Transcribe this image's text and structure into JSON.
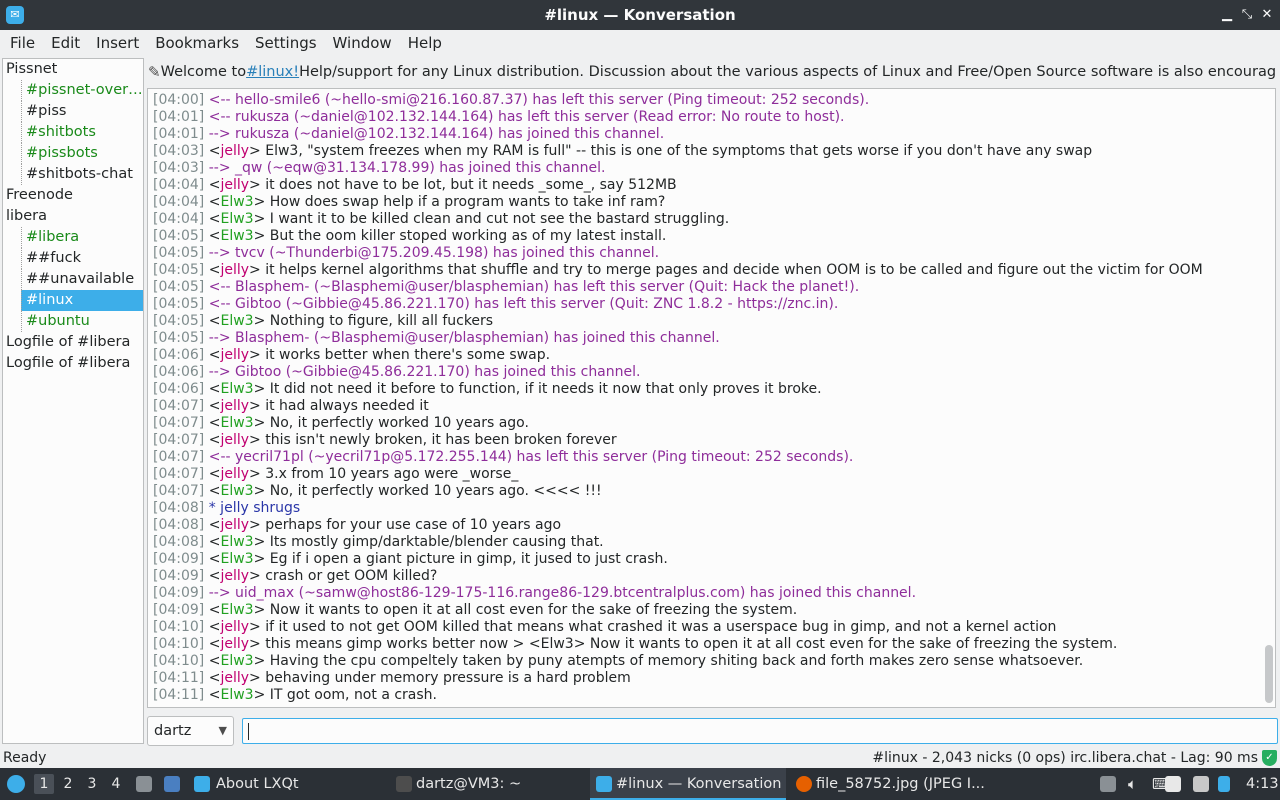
{
  "window": {
    "title": "#linux — Konversation"
  },
  "menubar": [
    "File",
    "Edit",
    "Insert",
    "Bookmarks",
    "Settings",
    "Window",
    "Help"
  ],
  "tree": [
    {
      "label": "Pissnet",
      "kind": "server"
    },
    {
      "label": "#pissnet-overview",
      "kind": "channel",
      "hl": true
    },
    {
      "label": "#piss",
      "kind": "channel",
      "hl": false
    },
    {
      "label": "#shitbots",
      "kind": "channel",
      "hl": true
    },
    {
      "label": "#pissbots",
      "kind": "channel",
      "hl": true
    },
    {
      "label": "#shitbots-chat",
      "kind": "channel",
      "hl": false
    },
    {
      "label": "Freenode",
      "kind": "server"
    },
    {
      "label": "libera",
      "kind": "server"
    },
    {
      "label": "#libera",
      "kind": "channel",
      "hl": true
    },
    {
      "label": "##fuck",
      "kind": "channel",
      "hl": false
    },
    {
      "label": "##unavailable",
      "kind": "channel",
      "hl": false
    },
    {
      "label": "#linux",
      "kind": "channel",
      "hl": false,
      "selected": true
    },
    {
      "label": "#ubuntu",
      "kind": "channel",
      "hl": true
    },
    {
      "label": "Logfile of #libera",
      "kind": "server"
    },
    {
      "label": "Logfile of #libera",
      "kind": "server"
    }
  ],
  "topic": {
    "prefix": "Welcome to ",
    "link": "#linux!",
    "rest": " Help/support for any Linux distribution. Discussion about the various aspects of Linux and Free/Open Source software is also encouraged. ..."
  },
  "messages": [
    {
      "ts": "[04:00]",
      "type": "sys",
      "text": "<-- hello-smile6 (~hello-smi@216.160.87.37) has left this server (Ping timeout: 252 seconds)."
    },
    {
      "ts": "[04:01]",
      "type": "sys",
      "text": "<-- rukusza (~daniel@102.132.144.164) has left this server (Read error: No route to host)."
    },
    {
      "ts": "[04:01]",
      "type": "sys",
      "text": "--> rukusza (~daniel@102.132.144.164) has joined this channel."
    },
    {
      "ts": "[04:03]",
      "type": "msg",
      "nick": "jelly",
      "text": " Elw3, \"system freezes when my RAM is full\" -- this is one of the symptoms that gets worse if you don't have any swap"
    },
    {
      "ts": "[04:03]",
      "type": "sys",
      "text": "--> _qw (~eqw@31.134.178.99) has joined this channel."
    },
    {
      "ts": "[04:04]",
      "type": "msg",
      "nick": "jelly",
      "text": " it does not have to be lot, but it needs _some_, say 512MB"
    },
    {
      "ts": "[04:04]",
      "type": "msg",
      "nick": "Elw3",
      "text": " How does swap help if a program wants to take inf ram?"
    },
    {
      "ts": "[04:04]",
      "type": "msg",
      "nick": "Elw3",
      "text": " I want it to be killed clean and cut not see the bastard struggling."
    },
    {
      "ts": "[04:05]",
      "type": "msg",
      "nick": "Elw3",
      "text": " But the oom killer stoped working as of my latest install."
    },
    {
      "ts": "[04:05]",
      "type": "sys",
      "text": "--> tvcv (~Thunderbi@175.209.45.198) has joined this channel."
    },
    {
      "ts": "[04:05]",
      "type": "msg",
      "nick": "jelly",
      "text": " it helps kernel algorithms that shuffle and try to merge pages and decide when OOM is to be called and figure out the victim for OOM"
    },
    {
      "ts": "[04:05]",
      "type": "sys",
      "text": "<-- Blasphem- (~Blasphemi@user/blasphemian) has left this server (Quit: Hack the planet!)."
    },
    {
      "ts": "[04:05]",
      "type": "sys",
      "text": "<-- Gibtoo (~Gibbie@45.86.221.170) has left this server (Quit: ZNC 1.8.2 - https://znc.in)."
    },
    {
      "ts": "[04:05]",
      "type": "msg",
      "nick": "Elw3",
      "text": " Nothing to figure, kill all fuckers"
    },
    {
      "ts": "[04:05]",
      "type": "sys",
      "text": "--> Blasphem- (~Blasphemi@user/blasphemian) has joined this channel."
    },
    {
      "ts": "[04:06]",
      "type": "msg",
      "nick": "jelly",
      "text": " it works better when there's some swap."
    },
    {
      "ts": "[04:06]",
      "type": "sys",
      "text": "--> Gibtoo (~Gibbie@45.86.221.170) has joined this channel."
    },
    {
      "ts": "[04:06]",
      "type": "msg",
      "nick": "Elw3",
      "text": " It did not need it before to function, if it needs it now that only proves it broke."
    },
    {
      "ts": "[04:07]",
      "type": "msg",
      "nick": "jelly",
      "text": " it had always needed it"
    },
    {
      "ts": "[04:07]",
      "type": "msg",
      "nick": "Elw3",
      "text": " No, it perfectly worked 10 years ago."
    },
    {
      "ts": "[04:07]",
      "type": "msg",
      "nick": "jelly",
      "text": " this isn't newly broken, it has been broken forever"
    },
    {
      "ts": "[04:07]",
      "type": "sys",
      "text": "<-- yecril71pl (~yecril71p@5.172.255.144) has left this server (Ping timeout: 252 seconds)."
    },
    {
      "ts": "[04:07]",
      "type": "msg",
      "nick": "jelly",
      "text": " 3.x from 10 years ago were _worse_"
    },
    {
      "ts": "[04:07]",
      "type": "msg",
      "nick": "Elw3",
      "text": " No, it perfectly worked 10 years ago. <<<< !!!"
    },
    {
      "ts": "[04:08]",
      "type": "action",
      "text": "* jelly shrugs"
    },
    {
      "ts": "[04:08]",
      "type": "msg",
      "nick": "jelly",
      "text": " perhaps for your use case of 10 years ago"
    },
    {
      "ts": "[04:08]",
      "type": "msg",
      "nick": "Elw3",
      "text": " Its mostly gimp/darktable/blender causing that."
    },
    {
      "ts": "[04:09]",
      "type": "msg",
      "nick": "Elw3",
      "text": " Eg if i open a giant picture in gimp, it jused to just crash."
    },
    {
      "ts": "[04:09]",
      "type": "msg",
      "nick": "jelly",
      "text": " crash or get OOM killed?"
    },
    {
      "ts": "[04:09]",
      "type": "sys",
      "text": "--> uid_max (~samw@host86-129-175-116.range86-129.btcentralplus.com) has joined this channel."
    },
    {
      "ts": "[04:09]",
      "type": "msg",
      "nick": "Elw3",
      "text": " Now it wants to open it at all cost even for the sake of freezing the system."
    },
    {
      "ts": "[04:10]",
      "type": "msg",
      "nick": "jelly",
      "text": " if it used to not get OOM killed that means what crashed it was a userspace bug in gimp, and not a kernel action"
    },
    {
      "ts": "[04:10]",
      "type": "msg",
      "nick": "jelly",
      "text": " this means gimp works better now > <Elw3> Now it wants to open it at all cost even for the sake of freezing the system."
    },
    {
      "ts": "[04:10]",
      "type": "msg",
      "nick": "Elw3",
      "text": " Having the cpu compeltely taken by puny atempts of memory shiting back and forth makes zero sense whatsoever."
    },
    {
      "ts": "[04:11]",
      "type": "msg",
      "nick": "jelly",
      "text": " behaving under memory pressure is a hard problem"
    },
    {
      "ts": "[04:11]",
      "type": "msg",
      "nick": "Elw3",
      "text": " IT got oom, not a crash."
    }
  ],
  "input": {
    "nick": "dartz",
    "value": ""
  },
  "status": {
    "left": "Ready",
    "right": "#linux - 2,043 nicks (0 ops)  irc.libera.chat - Lag: 90 ms"
  },
  "taskbar": {
    "desktops": [
      "1",
      "2",
      "3",
      "4"
    ],
    "tasks": [
      {
        "label": "About LXQt",
        "icon": "lxqt-icon"
      },
      {
        "label": "dartz@VM3: ~",
        "icon": "terminal-icon"
      },
      {
        "label": "#linux — Konversation",
        "icon": "konversation-icon"
      },
      {
        "label": "file_58752.jpg (JPEG I...",
        "icon": "firefox-icon"
      }
    ],
    "clock": "4:13"
  }
}
